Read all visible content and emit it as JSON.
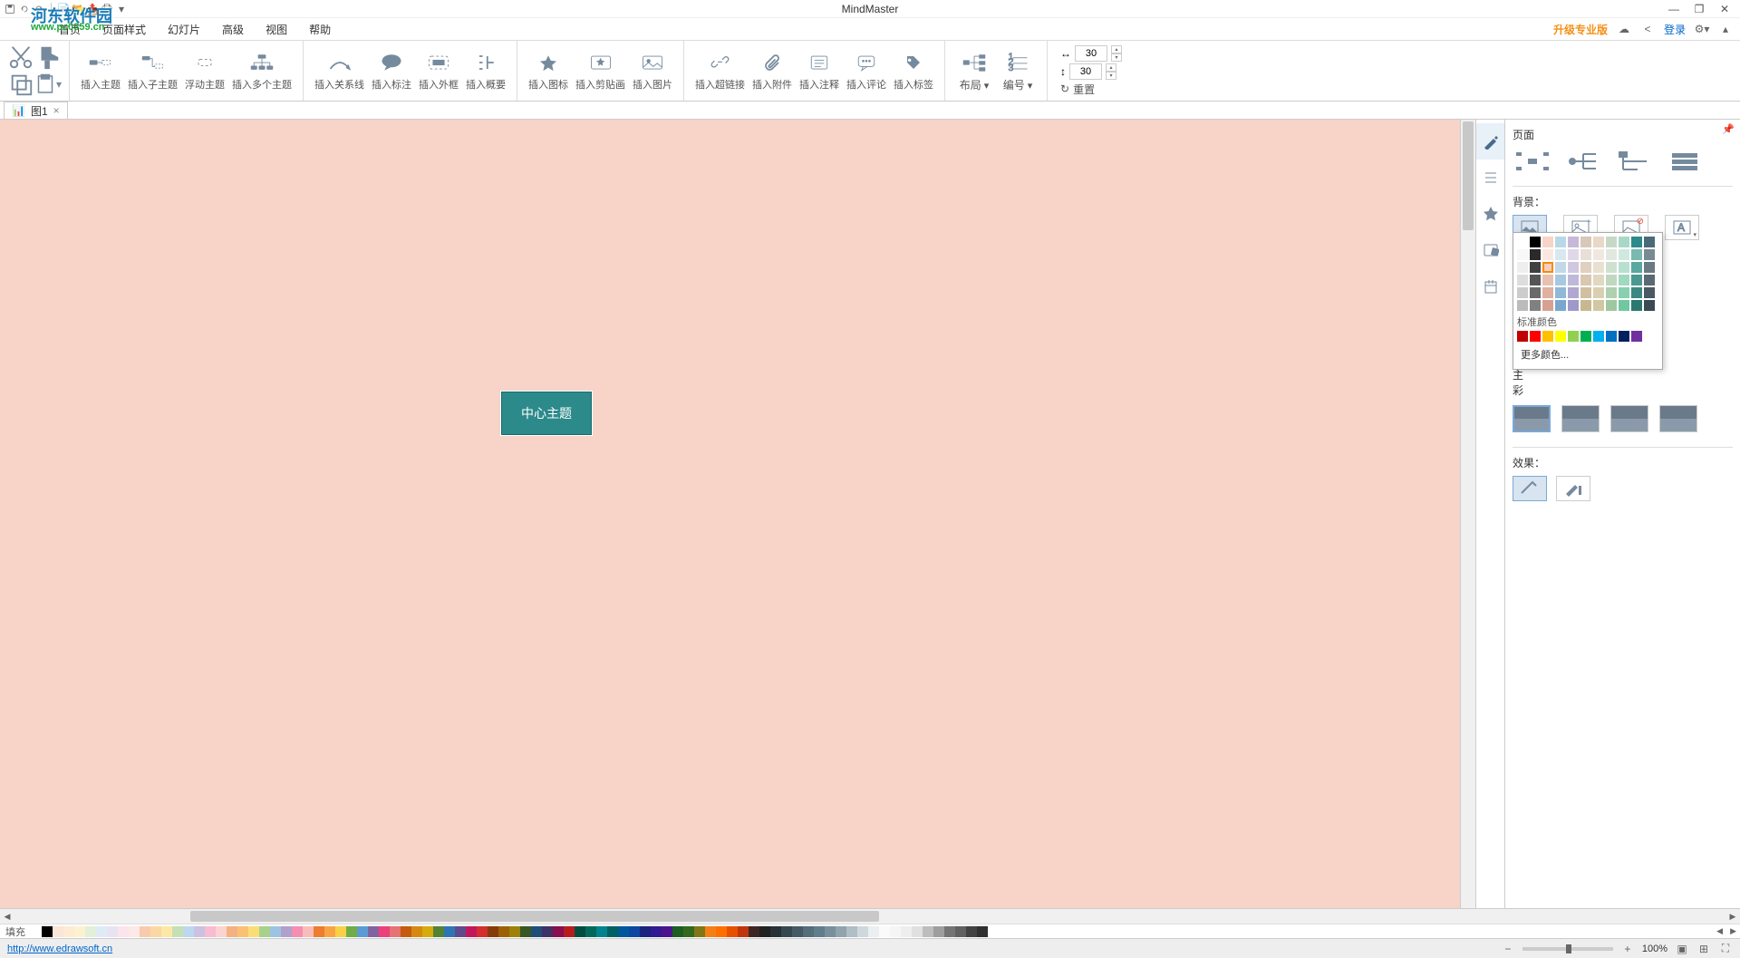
{
  "app_title": "MindMaster",
  "watermark": {
    "text": "河东软件园",
    "url": "www.pc0359.cn"
  },
  "menu": [
    "首页",
    "页面样式",
    "幻灯片",
    "高级",
    "视图",
    "帮助"
  ],
  "upgrade_text": "升级专业版",
  "login_text": "登录",
  "ribbon": {
    "insert_topic": "插入主题",
    "insert_subtopic": "插入子主题",
    "floating_topic": "浮动主题",
    "multi_topic": "插入多个主题",
    "relation": "插入关系线",
    "callout": "插入标注",
    "boundary": "插入外框",
    "summary": "插入概要",
    "icon": "插入图标",
    "clipart": "插入剪贴画",
    "image": "插入图片",
    "hyperlink": "插入超链接",
    "attachment": "插入附件",
    "note": "插入注释",
    "comment": "插入评论",
    "tag": "插入标签",
    "layout": "布局",
    "numbering": "编号",
    "spacing_h": "30",
    "spacing_v": "30",
    "reset": "重置"
  },
  "tab": {
    "name": "图1"
  },
  "canvas": {
    "central_topic": "中心主题"
  },
  "panel": {
    "title": "页面",
    "bg_label": "背景：",
    "theme_prefix": "主",
    "color_prefix": "彩",
    "std_colors": "标准颜色",
    "more_colors": "更多颜色...",
    "effect_label": "效果："
  },
  "palette_label": "填充",
  "status": {
    "url": "http://www.edrawsoft.cn",
    "zoom": "100%"
  },
  "theme_colors": [
    [
      "#ffffff",
      "#000000",
      "#f8d3c8",
      "#b8d8e8",
      "#c8b8d8",
      "#d8c8b8",
      "#e8d8c8",
      "#c8d8c8",
      "#a8d8c8",
      "#2c8a8a",
      "#4a6a7a"
    ],
    [
      "#f8f8f8",
      "#2a2a2a",
      "#fae8e0",
      "#d8e8f0",
      "#e0d8e8",
      "#e8e0d8",
      "#f0e8e0",
      "#e0e8e0",
      "#d0e8e0",
      "#7ab8b0",
      "#7a8a92"
    ],
    [
      "#eeeeee",
      "#404040",
      "#f0d0c0",
      "#c0d8e8",
      "#d0c8e0",
      "#e0d0c0",
      "#e8e0d0",
      "#d0e0d0",
      "#b8e0d0",
      "#5aa8a0",
      "#6a7a82"
    ],
    [
      "#dddddd",
      "#555555",
      "#e8c0b0",
      "#a8c8e0",
      "#c0b8d8",
      "#d8c8b0",
      "#e0d8c0",
      "#c0d8c0",
      "#a0d8c0",
      "#4a9890",
      "#5a6a72"
    ],
    [
      "#cccccc",
      "#6a6a6a",
      "#e0b0a0",
      "#90b8d8",
      "#b0a8d0",
      "#d0c0a0",
      "#d8d0b0",
      "#b0d0b0",
      "#88d0b0",
      "#3a8880",
      "#4a5a62"
    ],
    [
      "#bbbbbb",
      "#808080",
      "#d8a090",
      "#78a8d0",
      "#a098c8",
      "#c8b890",
      "#d0c8a0",
      "#a0c8a0",
      "#70c8a0",
      "#2a7870",
      "#3a4a52"
    ]
  ],
  "standard_colors": [
    "#c00000",
    "#ff0000",
    "#ffc000",
    "#ffff00",
    "#92d050",
    "#00b050",
    "#00b0f0",
    "#0070c0",
    "#002060",
    "#7030a0"
  ],
  "palette_colors": [
    "#ffffff",
    "#000000",
    "#fbe5d6",
    "#fdebd3",
    "#fdf2d0",
    "#e2f0d9",
    "#deebf7",
    "#e8e3f3",
    "#fce4ec",
    "#fde9e8",
    "#f8cbad",
    "#fbd7a3",
    "#fce8a5",
    "#c5e0b4",
    "#bdd7ee",
    "#ccc1e0",
    "#f8bbd0",
    "#fbd3d0",
    "#f4b183",
    "#f9c174",
    "#fbdd76",
    "#a9d18e",
    "#9dc3e4",
    "#b1a0cc",
    "#f48fb1",
    "#f8bdb8",
    "#ed7d31",
    "#f7a544",
    "#f9d147",
    "#70ad47",
    "#5b9bd5",
    "#8064a2",
    "#ec407a",
    "#e57373",
    "#c55a11",
    "#d68910",
    "#d4ac0d",
    "#548235",
    "#2e75b6",
    "#5f4b8b",
    "#c2185b",
    "#d32f2f",
    "#843c0c",
    "#9c6107",
    "#9e8108",
    "#385723",
    "#1f4e79",
    "#3f3065",
    "#880e4f",
    "#b71c1c",
    "#004d40",
    "#00695c",
    "#00838f",
    "#006064",
    "#01579b",
    "#0d47a1",
    "#1a237e",
    "#311b92",
    "#4a148c",
    "#1b5e20",
    "#33691e",
    "#827717",
    "#f57f17",
    "#ff6f00",
    "#e65100",
    "#bf360c",
    "#3e2723",
    "#212121",
    "#263238",
    "#37474f",
    "#455a64",
    "#546e7a",
    "#607d8b",
    "#78909c",
    "#90a4ae",
    "#b0bec5",
    "#cfd8dc",
    "#eceff1",
    "#fafafa",
    "#f5f5f5",
    "#eeeeee",
    "#e0e0e0",
    "#bdbdbd",
    "#9e9e9e",
    "#757575",
    "#616161",
    "#424242",
    "#303030"
  ]
}
